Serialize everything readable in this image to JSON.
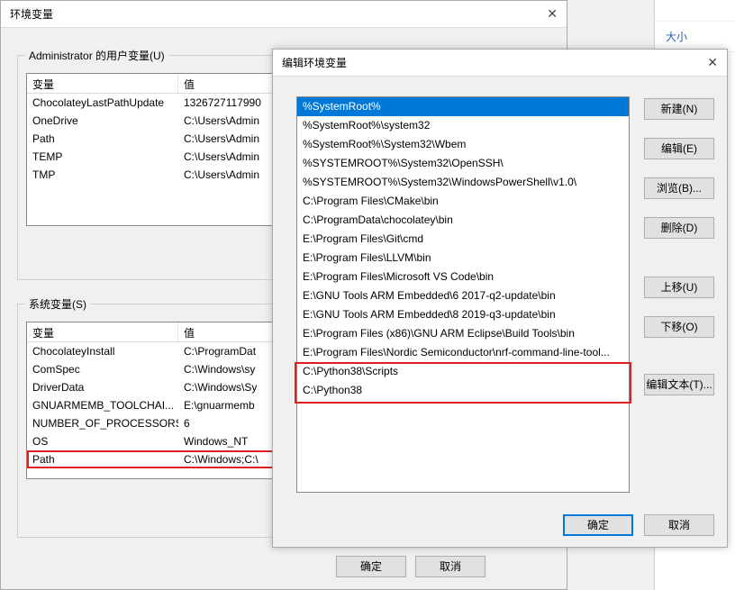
{
  "topright": {
    "header": "大小"
  },
  "env_window": {
    "title": "环境变量",
    "user_group_label": "Administrator 的用户变量(U)",
    "sys_group_label": "系统变量(S)",
    "col_var": "变量",
    "col_val": "值",
    "user_vars": [
      {
        "name": "ChocolateyLastPathUpdate",
        "value": "1326727117990"
      },
      {
        "name": "OneDrive",
        "value": "C:\\Users\\Admin"
      },
      {
        "name": "Path",
        "value": "C:\\Users\\Admin"
      },
      {
        "name": "TEMP",
        "value": "C:\\Users\\Admin"
      },
      {
        "name": "TMP",
        "value": "C:\\Users\\Admin"
      }
    ],
    "sys_vars": [
      {
        "name": "ChocolateyInstall",
        "value": "C:\\ProgramDat"
      },
      {
        "name": "ComSpec",
        "value": "C:\\Windows\\sy"
      },
      {
        "name": "DriverData",
        "value": "C:\\Windows\\Sy"
      },
      {
        "name": "GNUARMEMB_TOOLCHAI...",
        "value": "E:\\gnuarmemb"
      },
      {
        "name": "NUMBER_OF_PROCESSORS",
        "value": "6"
      },
      {
        "name": "OS",
        "value": "Windows_NT"
      },
      {
        "name": "Path",
        "value": "C:\\Windows;C:\\"
      }
    ],
    "ok_label": "确定",
    "cancel_label": "取消"
  },
  "edit_window": {
    "title": "编辑环境变量",
    "items": [
      "%SystemRoot%",
      "%SystemRoot%\\system32",
      "%SystemRoot%\\System32\\Wbem",
      "%SYSTEMROOT%\\System32\\OpenSSH\\",
      "%SYSTEMROOT%\\System32\\WindowsPowerShell\\v1.0\\",
      "C:\\Program Files\\CMake\\bin",
      "C:\\ProgramData\\chocolatey\\bin",
      "E:\\Program Files\\Git\\cmd",
      "E:\\Program Files\\LLVM\\bin",
      "E:\\Program Files\\Microsoft VS Code\\bin",
      "E:\\GNU Tools ARM Embedded\\6 2017-q2-update\\bin",
      "E:\\GNU Tools ARM Embedded\\8 2019-q3-update\\bin",
      "E:\\Program Files (x86)\\GNU ARM Eclipse\\Build Tools\\bin",
      "E:\\Program Files\\Nordic Semiconductor\\nrf-command-line-tool...",
      "C:\\Python38\\Scripts",
      "C:\\Python38"
    ],
    "buttons": {
      "new": "新建(N)",
      "edit": "编辑(E)",
      "browse": "浏览(B)...",
      "delete": "删除(D)",
      "moveup": "上移(U)",
      "movedown": "下移(O)",
      "edittext": "编辑文本(T)...",
      "ok": "确定",
      "cancel": "取消"
    }
  }
}
